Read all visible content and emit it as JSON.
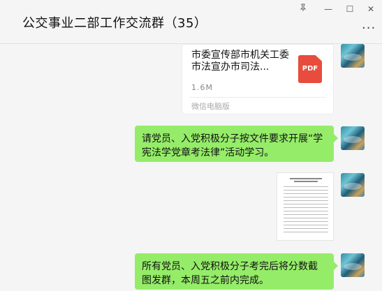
{
  "window": {
    "title": "公交事业二部工作交流群（35）",
    "pin_icon": "pin-icon",
    "minimize_label": "—",
    "maximize_label": "☐",
    "close_label": "✕",
    "more_label": "···"
  },
  "messages": {
    "file": {
      "name": "市委宣传部市机关工委市法宣办市司法...",
      "size": "1.6M",
      "source": "微信电脑版",
      "type_label": "PDF"
    },
    "text1": "请党员、入党积极分子按文件要求开展“学宪法学党章考法律”活动学习。",
    "image_title": "第二届“学宪法学党章考法律”活动实施方案",
    "text2": "所有党员、入党积极分子考完后将分数截图发群，本周五之前内完成。"
  },
  "colors": {
    "bubble": "#95ec69",
    "background": "#f5f5f5",
    "pdf": "#e84c3d"
  }
}
